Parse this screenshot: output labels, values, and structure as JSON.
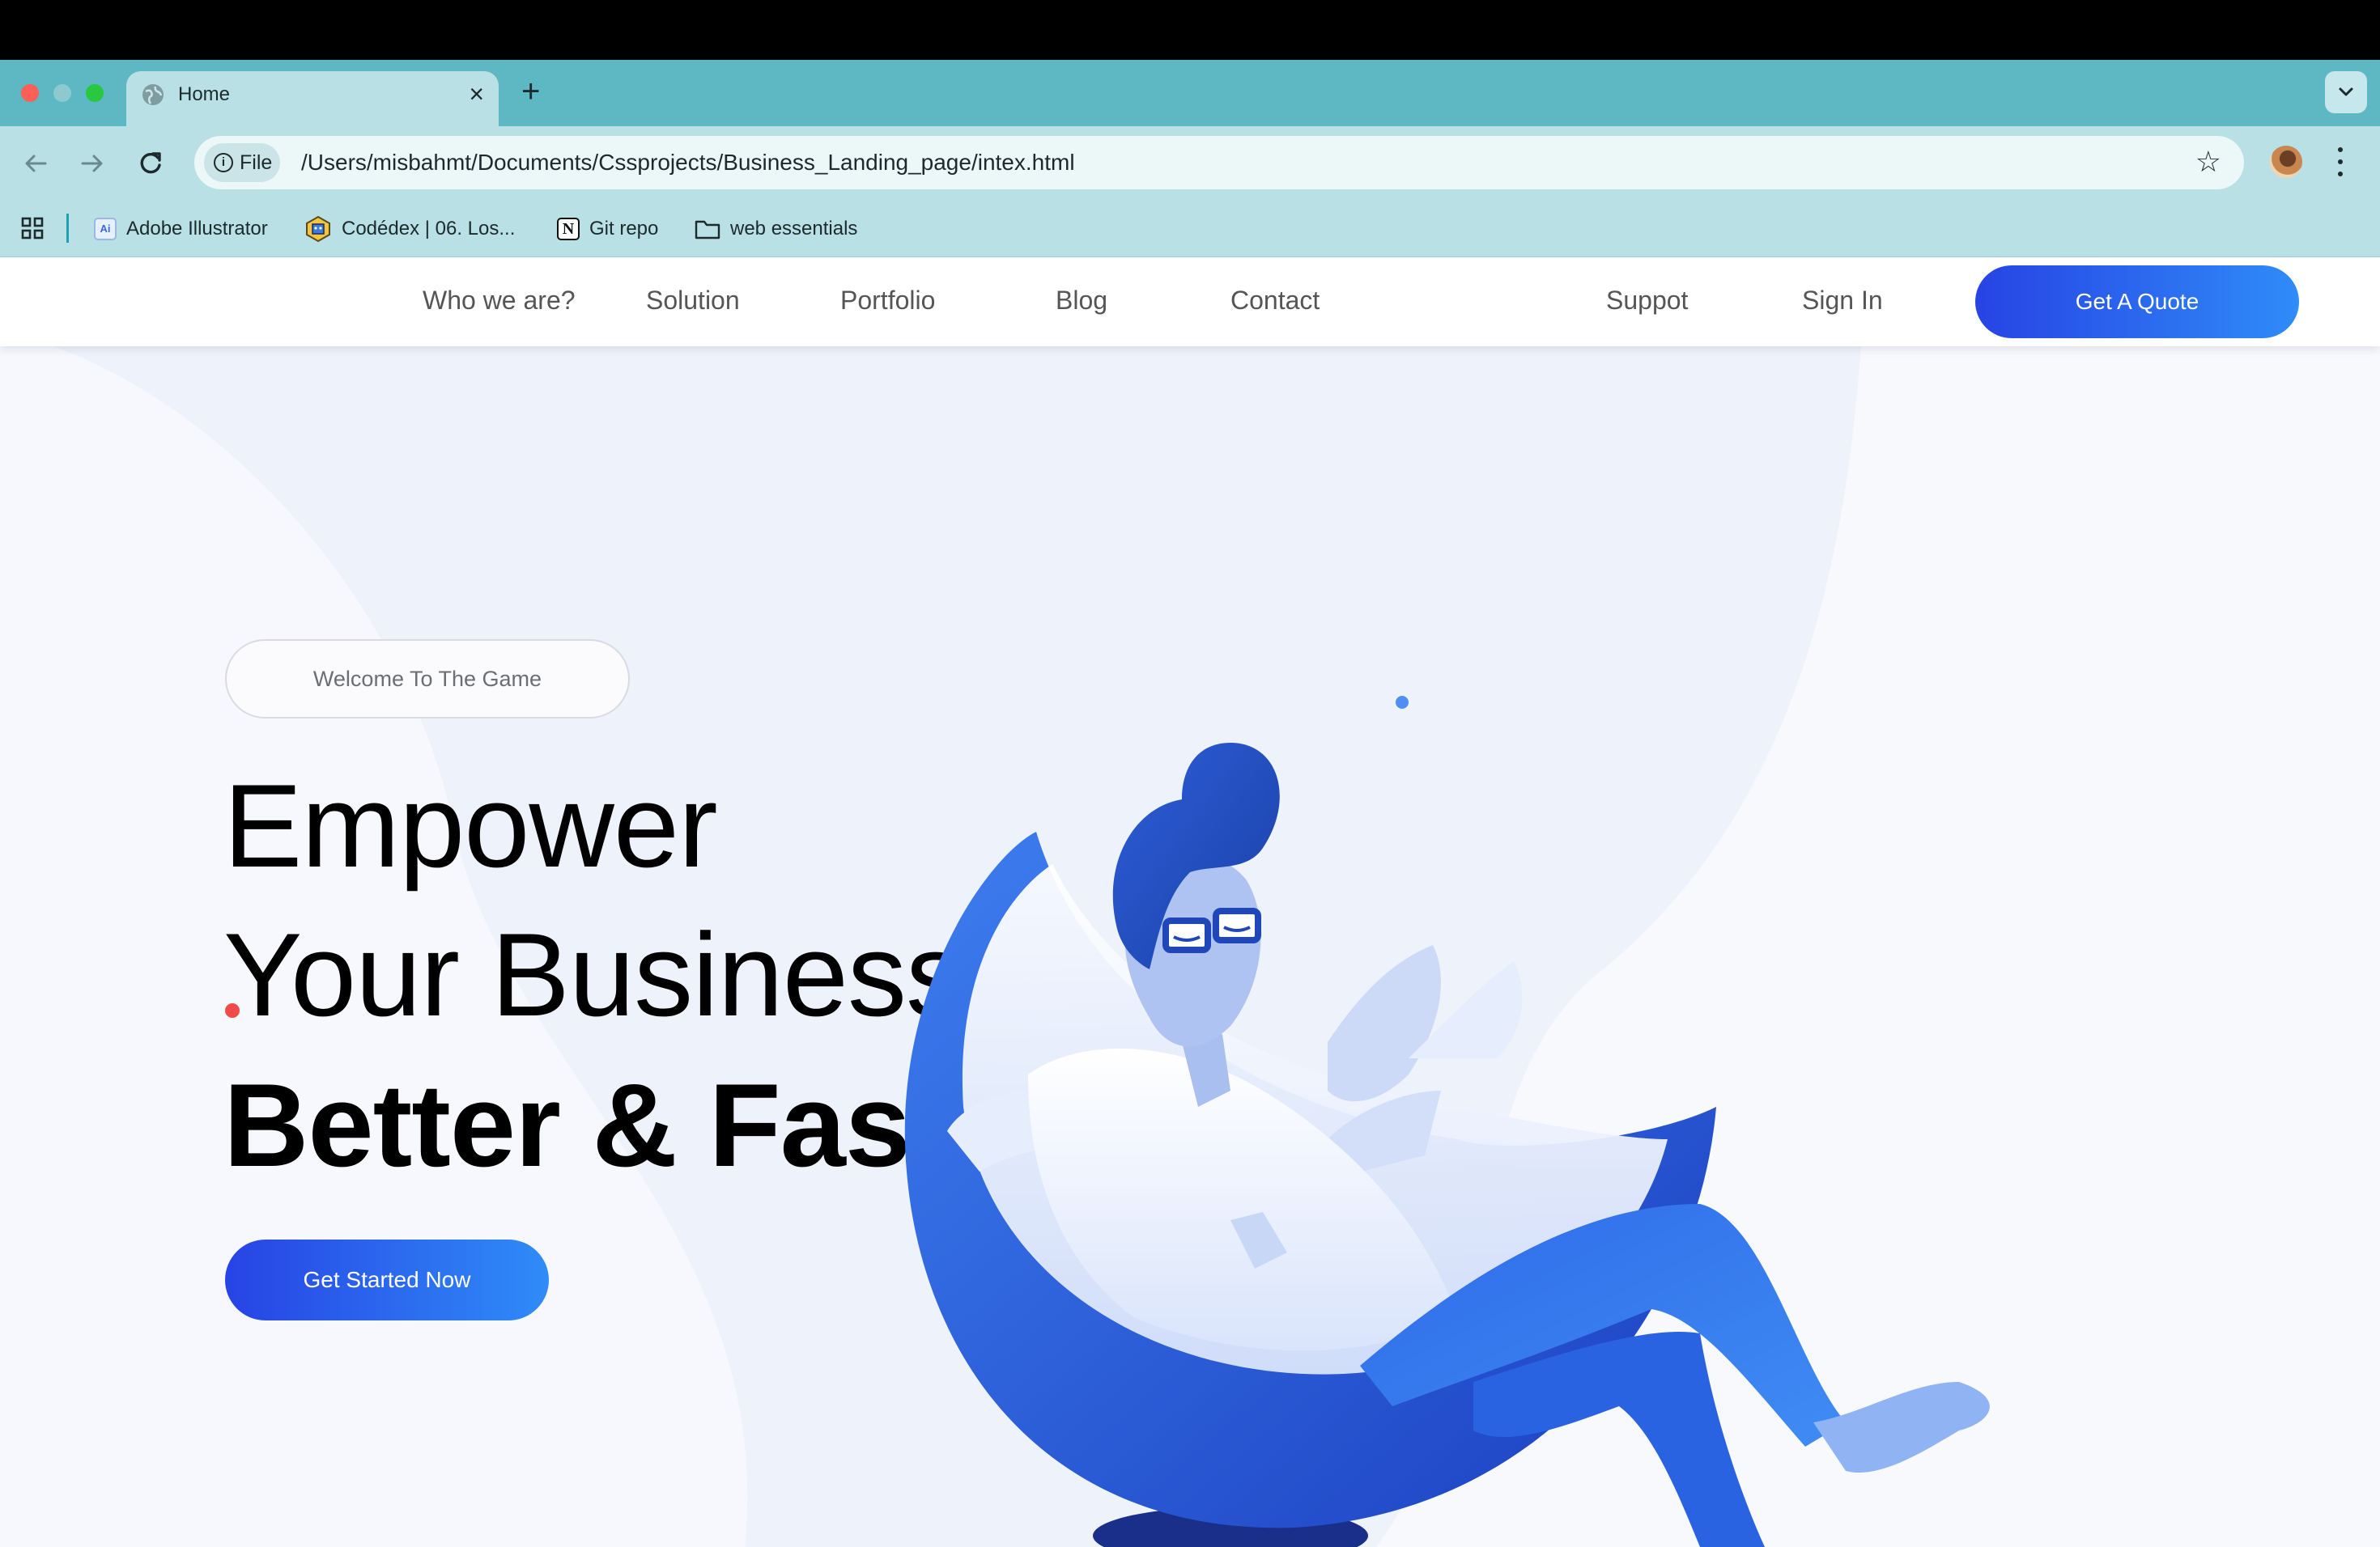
{
  "browser": {
    "tab": {
      "title": "Home",
      "close_glyph": "×"
    },
    "new_tab_glyph": "+",
    "address": {
      "chip_label": "File",
      "chip_icon": "i",
      "url": "/Users/misbahmt/Documents/Cssprojects/Business_Landing_page/intex.html",
      "bookmark_glyph": "☆"
    },
    "bookmarks": [
      {
        "label": "Adobe Illustrator",
        "icon": "adobe-illustrator-icon",
        "icon_text": "Ai"
      },
      {
        "label": "Codédex | 06. Los...",
        "icon": "codedex-icon"
      },
      {
        "label": "Git repo",
        "icon": "notion-icon",
        "icon_text": "N"
      },
      {
        "label": "web essentials",
        "icon": "folder-icon"
      }
    ]
  },
  "site": {
    "nav": {
      "links": [
        {
          "label": "Who we are?"
        },
        {
          "label": "Solution"
        },
        {
          "label": "Portfolio"
        },
        {
          "label": "Blog"
        },
        {
          "label": "Contact"
        },
        {
          "label": "Suppot"
        },
        {
          "label": "Sign In"
        }
      ],
      "cta": "Get A Quote"
    },
    "hero": {
      "badge": "Welcome To The Game",
      "headline": [
        "Empower",
        "Your Business",
        "Better & Faster"
      ],
      "cta": "Get Started Now"
    }
  },
  "colors": {
    "tabstrip": "#5db8c3",
    "toolbar": "#b8e0e5",
    "page_bg": "#f8f9fd",
    "accent_start": "#2743e4",
    "accent_end": "#2f8cf8"
  }
}
